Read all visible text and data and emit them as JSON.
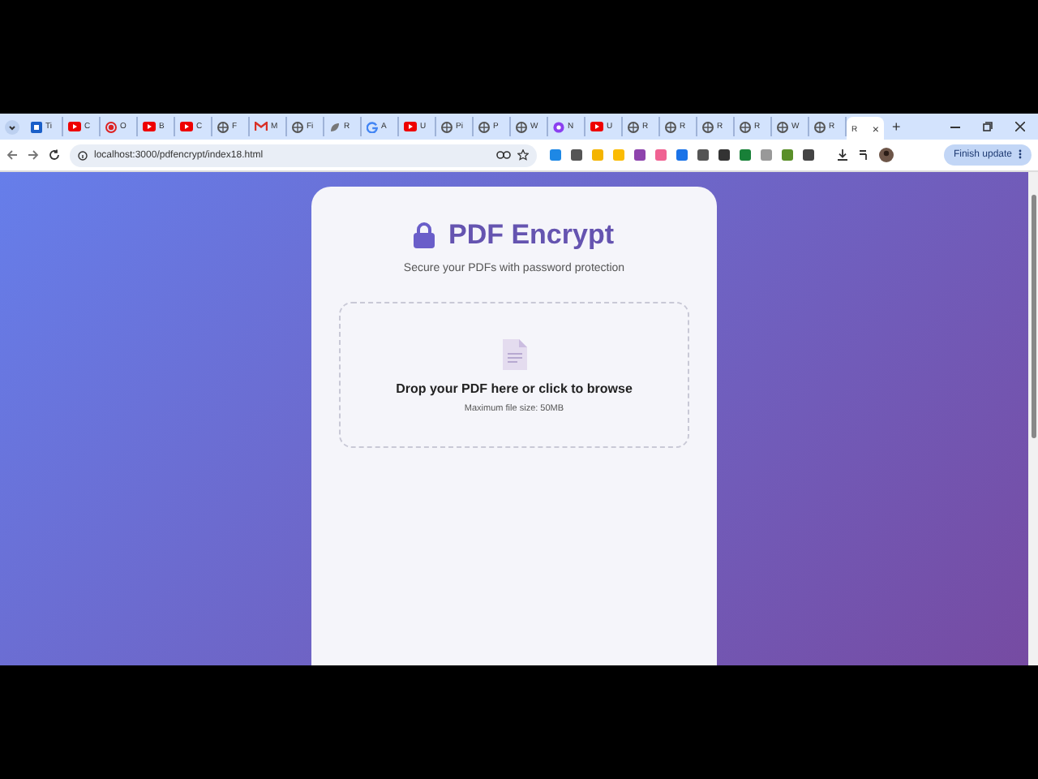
{
  "browser": {
    "tabs": [
      {
        "kind": "blue",
        "label": "Ti",
        "selected": false
      },
      {
        "kind": "video",
        "label": "C",
        "selected": false
      },
      {
        "kind": "ring",
        "label": "O",
        "selected": false
      },
      {
        "kind": "video",
        "label": "B",
        "selected": false
      },
      {
        "kind": "video",
        "label": "C",
        "selected": false
      },
      {
        "kind": "globe",
        "label": "F",
        "selected": false
      },
      {
        "kind": "mail",
        "label": "M",
        "selected": false
      },
      {
        "kind": "globe",
        "label": "Fi",
        "selected": false
      },
      {
        "kind": "leaf",
        "label": "R",
        "selected": false
      },
      {
        "kind": "google",
        "label": "A",
        "selected": false
      },
      {
        "kind": "video",
        "label": "U",
        "selected": false
      },
      {
        "kind": "globe",
        "label": "Pi",
        "selected": false
      },
      {
        "kind": "globe",
        "label": "P",
        "selected": false
      },
      {
        "kind": "globe",
        "label": "W",
        "selected": false
      },
      {
        "kind": "purple",
        "label": "N",
        "selected": false
      },
      {
        "kind": "video",
        "label": "U",
        "selected": false
      },
      {
        "kind": "globe",
        "label": "R",
        "selected": false
      },
      {
        "kind": "globe",
        "label": "R",
        "selected": false
      },
      {
        "kind": "globe",
        "label": "R",
        "selected": false
      },
      {
        "kind": "globe",
        "label": "R",
        "selected": false
      },
      {
        "kind": "globe",
        "label": "W",
        "selected": false
      },
      {
        "kind": "globe",
        "label": "R",
        "selected": false
      },
      {
        "kind": "none",
        "label": "R",
        "selected": true
      }
    ],
    "new_tab": "+",
    "close_tab": "×",
    "address": "localhost:3000/pdfencrypt/index18.html",
    "update_button": "Finish update"
  },
  "card": {
    "title": "PDF Encrypt",
    "subtitle": "Secure your PDFs with password protection",
    "dropzone": {
      "heading": "Drop your PDF here or click to browse",
      "hint": "Maximum file size: 50MB"
    }
  }
}
